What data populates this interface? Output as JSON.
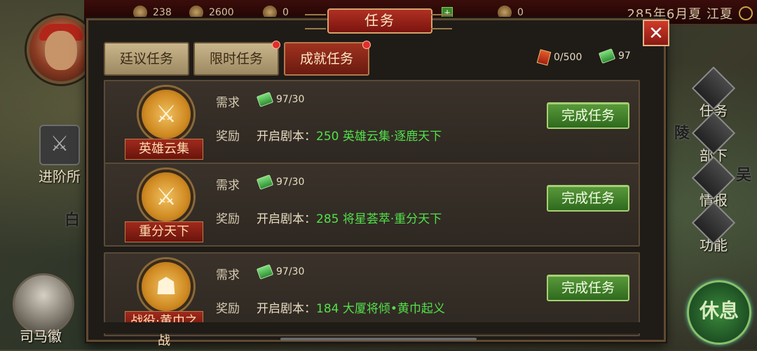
{
  "topbar": {
    "resources": [
      "238",
      "2600",
      "0",
      "0"
    ],
    "date": "285年6月夏 江夏"
  },
  "left": {
    "advance_label": "进阶所",
    "advisor_name": "司马徽",
    "map_text": "白"
  },
  "right_menu": {
    "items": [
      "任务",
      "部下",
      "情报",
      "功能"
    ],
    "rest_label": "休息",
    "map_texts": [
      "陵",
      "吴"
    ]
  },
  "modal": {
    "title": "任务",
    "close_label": "✕",
    "tabs": [
      {
        "label": "廷议任务",
        "active": false,
        "notify": false
      },
      {
        "label": "限时任务",
        "active": false,
        "notify": true
      },
      {
        "label": "成就任务",
        "active": true,
        "notify": true
      }
    ],
    "counters": {
      "scrolls": "0/500",
      "jade": "97"
    },
    "req_label": "需求",
    "rew_label": "奖励",
    "reward_prefix": "开启剧本：",
    "button_label": "完成任务",
    "tasks": [
      {
        "name": "英雄云集",
        "icon": "crossed-swords-icon",
        "glyph": "⚔",
        "requirement": "97/30",
        "reward": "250 英雄云集·逐鹿天下"
      },
      {
        "name": "重分天下",
        "icon": "crossed-swords-icon",
        "glyph": "⚔",
        "requirement": "97/30",
        "reward": "285 将星荟萃·重分天下"
      },
      {
        "name": "战役·黄巾之战",
        "icon": "warrior-helmet-icon",
        "glyph": "☗",
        "requirement": "97/30",
        "reward": "184 大厦将倾•黄巾起义"
      }
    ]
  }
}
